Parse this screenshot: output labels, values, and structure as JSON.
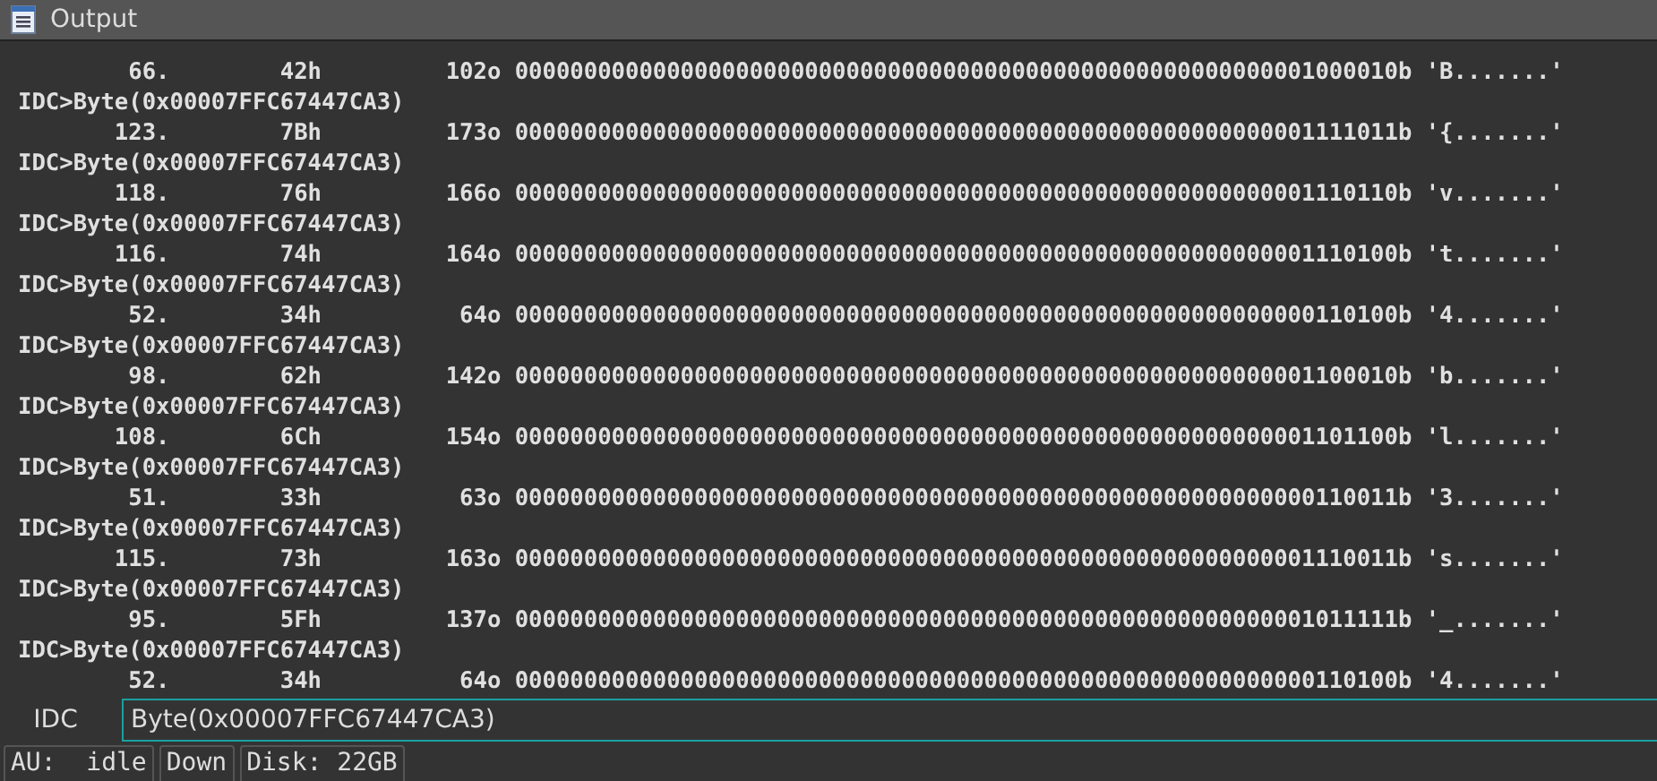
{
  "window": {
    "title": "Output"
  },
  "output": [
    {
      "decimal": "66.",
      "hex": "42h",
      "octal": "102o",
      "binary": "0000000000000000000000000000000000000000000000000000000001000010b",
      "char": "'B.......'"
    },
    {
      "command": "IDC>Byte(0x00007FFC67447CA3)",
      "decimal": "123.",
      "hex": "7Bh",
      "octal": "173o",
      "binary": "0000000000000000000000000000000000000000000000000000000001111011b",
      "char": "'{.......'"
    },
    {
      "command": "IDC>Byte(0x00007FFC67447CA3)",
      "decimal": "118.",
      "hex": "76h",
      "octal": "166o",
      "binary": "0000000000000000000000000000000000000000000000000000000001110110b",
      "char": "'v.......'"
    },
    {
      "command": "IDC>Byte(0x00007FFC67447CA3)",
      "decimal": "116.",
      "hex": "74h",
      "octal": "164o",
      "binary": "0000000000000000000000000000000000000000000000000000000001110100b",
      "char": "'t.......'"
    },
    {
      "command": "IDC>Byte(0x00007FFC67447CA3)",
      "decimal": "52.",
      "hex": "34h",
      "octal": "64o",
      "binary": "0000000000000000000000000000000000000000000000000000000000110100b",
      "char": "'4.......'"
    },
    {
      "command": "IDC>Byte(0x00007FFC67447CA3)",
      "decimal": "98.",
      "hex": "62h",
      "octal": "142o",
      "binary": "0000000000000000000000000000000000000000000000000000000001100010b",
      "char": "'b.......'"
    },
    {
      "command": "IDC>Byte(0x00007FFC67447CA3)",
      "decimal": "108.",
      "hex": "6Ch",
      "octal": "154o",
      "binary": "0000000000000000000000000000000000000000000000000000000001101100b",
      "char": "'l.......'"
    },
    {
      "command": "IDC>Byte(0x00007FFC67447CA3)",
      "decimal": "51.",
      "hex": "33h",
      "octal": "63o",
      "binary": "0000000000000000000000000000000000000000000000000000000000110011b",
      "char": "'3.......'"
    },
    {
      "command": "IDC>Byte(0x00007FFC67447CA3)",
      "decimal": "115.",
      "hex": "73h",
      "octal": "163o",
      "binary": "0000000000000000000000000000000000000000000000000000000001110011b",
      "char": "'s.......'"
    },
    {
      "command": "IDC>Byte(0x00007FFC67447CA3)",
      "decimal": "95.",
      "hex": "5Fh",
      "octal": "137o",
      "binary": "0000000000000000000000000000000000000000000000000000000001011111b",
      "char": "'_.......'"
    },
    {
      "command": "IDC>Byte(0x00007FFC67447CA3)",
      "decimal": "52.",
      "hex": "34h",
      "octal": "64o",
      "binary": "0000000000000000000000000000000000000000000000000000000000110100b",
      "char": "'4.......'"
    }
  ],
  "input": {
    "label": "IDC",
    "value": "Byte(0x00007FFC67447CA3)"
  },
  "status_bar": [
    "AU:  idle",
    "Down",
    "Disk: 22GB"
  ]
}
